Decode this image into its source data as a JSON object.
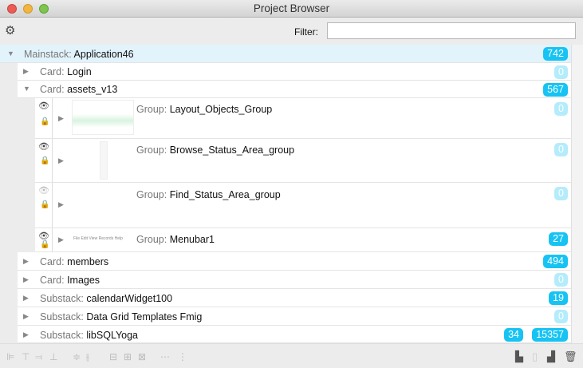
{
  "window": {
    "title": "Project Browser"
  },
  "toolbar": {
    "filter_label": "Filter:",
    "filter_value": "",
    "gear_icon": "gear-icon"
  },
  "colors": {
    "badge": "#17c3f3",
    "badge_zero": "#b4ecfb",
    "selected_row": "#e2f3fc"
  },
  "tree": {
    "mainstack": {
      "kind": "Mainstack:",
      "name": "Application46",
      "count": "742"
    },
    "cards": [
      {
        "kind": "Card:",
        "name": "Login",
        "count": "0"
      },
      {
        "kind": "Card:",
        "name": "assets_v13",
        "count": "567"
      }
    ],
    "groups": [
      {
        "kind": "Group:",
        "name": "Layout_Objects_Group",
        "count": "0",
        "visible": true
      },
      {
        "kind": "Group:",
        "name": "Browse_Status_Area_group",
        "count": "0",
        "visible": true
      },
      {
        "kind": "Group:",
        "name": "Find_Status_Area_group",
        "count": "0",
        "visible": false
      },
      {
        "kind": "Group:",
        "name": "Menubar1",
        "count": "27",
        "visible": true,
        "thumb_text": "File  Edit  View  Records  Help"
      }
    ],
    "after": [
      {
        "kind": "Card:",
        "name": "members",
        "count": "494"
      },
      {
        "kind": "Card:",
        "name": "Images",
        "count": "0"
      },
      {
        "kind": "Substack:",
        "name": "calendarWidget100",
        "count": "19"
      },
      {
        "kind": "Substack:",
        "name": "Data Grid Templates Fmig",
        "count": "0"
      },
      {
        "kind": "Substack:",
        "name": "libSQLYoga",
        "count": "15357",
        "count2": "34"
      }
    ]
  }
}
